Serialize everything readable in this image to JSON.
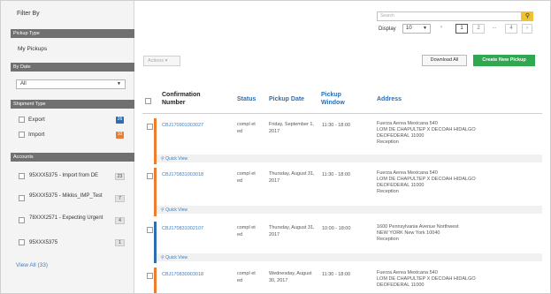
{
  "sidebar": {
    "filter_by": "Filter By",
    "pickup_type_header": "Pickup Type",
    "my_pickups": "My Pickups",
    "by_date_header": "By Date",
    "date_select_value": "All",
    "shipment_type_header": "Shipment Type",
    "export_label": "Export",
    "export_count": "26",
    "import_label": "Import",
    "import_count": "10",
    "accounts_header": "Accounts",
    "accounts": [
      {
        "label": "95XXX5375 - Import from DE",
        "count": "23"
      },
      {
        "label": "95XXX5375 - Miklos_IMP_Test",
        "count": "7"
      },
      {
        "label": "78XXX2571 - Expecting Urgent",
        "count": "4"
      },
      {
        "label": "95XXX5375",
        "count": "1"
      }
    ],
    "view_all": "View All (33)"
  },
  "toolbar": {
    "search_placeholder": "Search",
    "display_label": "Display",
    "display_value": "10",
    "pages": [
      "1",
      "2",
      "...",
      "4"
    ],
    "actions_label": "Actions ▾",
    "download_label": "Download All",
    "create_label": "Create New Pickup"
  },
  "table": {
    "headers": {
      "confirmation": "Confirmation Number",
      "status": "Status",
      "date": "Pickup Date",
      "window": "Pickup Window",
      "address": "Address"
    },
    "rows": [
      {
        "conf": "CBJ170901003027",
        "status": "compl et ed",
        "date": "Friday, September 1, 2017",
        "window": "11:30 - 18:00",
        "address": "Fuerza Aerea Mexicana 540\nLOM DE CHAPULTEP X DECOAH HIDALGO\nDEOFEDERAL 11000\nReception",
        "quick_view": "Quick View",
        "color": "#f07a2e"
      },
      {
        "conf": "CBJ170831003018",
        "status": "compl et ed",
        "date": "Thursday, August 31, 2017",
        "window": "11:30 - 18:00",
        "address": "Fuerza Aerea Mexicana 540\nLOM DE CHAPULTEP X DECOAH HIDALGO\nDEOFEDERAL 11000\nReception",
        "quick_view": "Quick View",
        "color": "#f07a2e"
      },
      {
        "conf": "CBJ170831002107",
        "status": "compl et ed",
        "date": "Thursday, August 31, 2017",
        "window": "10:00 - 18:00",
        "address": "1600 Pennsylvania Avenue Northwest\nNEW YORK New York 10040\nReception",
        "quick_view": "Quick View",
        "color": "#2f6db3"
      },
      {
        "conf": "CBJ170830003018",
        "status": "compl et ed",
        "date": "Wednesday, August 30, 2017",
        "window": "11:30 - 18:00",
        "address": "Fuerza Aerea Mexicana 540\nLOM DE CHAPULTEP X DECOAH HIDALGO\nDEOFEDERAL 11000",
        "quick_view": "Quick View",
        "color": "#f07a2e"
      }
    ]
  }
}
